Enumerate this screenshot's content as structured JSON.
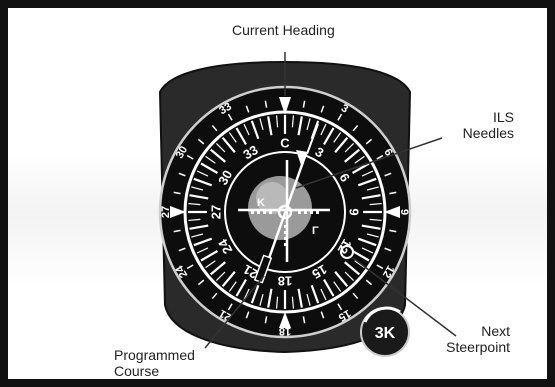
{
  "callouts": {
    "current_heading": "Current Heading",
    "ils_line1": "ILS",
    "ils_line2": "Needles",
    "next_line1": "Next",
    "next_line2": "Steerpoint",
    "course_line1": "Programmed",
    "course_line2": "Course"
  },
  "compass": {
    "cardinal_labels": [
      {
        "text": "C",
        "bearing": 0
      },
      {
        "text": "3",
        "bearing": 30
      },
      {
        "text": "6",
        "bearing": 60
      },
      {
        "text": "9",
        "bearing": 90
      },
      {
        "text": "12",
        "bearing": 120
      },
      {
        "text": "15",
        "bearing": 150
      },
      {
        "text": "18",
        "bearing": 180
      },
      {
        "text": "21",
        "bearing": 210
      },
      {
        "text": "24",
        "bearing": 240
      },
      {
        "text": "27",
        "bearing": 270
      },
      {
        "text": "30",
        "bearing": 300
      },
      {
        "text": "33",
        "bearing": 330
      }
    ],
    "outer_labels": [
      {
        "text": "3",
        "bearing": 30
      },
      {
        "text": "6",
        "bearing": 60
      },
      {
        "text": "9",
        "bearing": 90
      },
      {
        "text": "12",
        "bearing": 120
      },
      {
        "text": "15",
        "bearing": 150
      },
      {
        "text": "18",
        "bearing": 180
      },
      {
        "text": "21",
        "bearing": 210
      },
      {
        "text": "24",
        "bearing": 240
      },
      {
        "text": "27",
        "bearing": 270
      },
      {
        "text": "30",
        "bearing": 300
      },
      {
        "text": "33",
        "bearing": 330
      }
    ],
    "inner_letter_left": "K",
    "inner_letter_right": "Γ",
    "knob_label": "3K"
  },
  "colors": {
    "bezel": "#2a2a2a",
    "dial": "#0d0d0d",
    "marking": "#ffffff",
    "leader": "#333333"
  }
}
